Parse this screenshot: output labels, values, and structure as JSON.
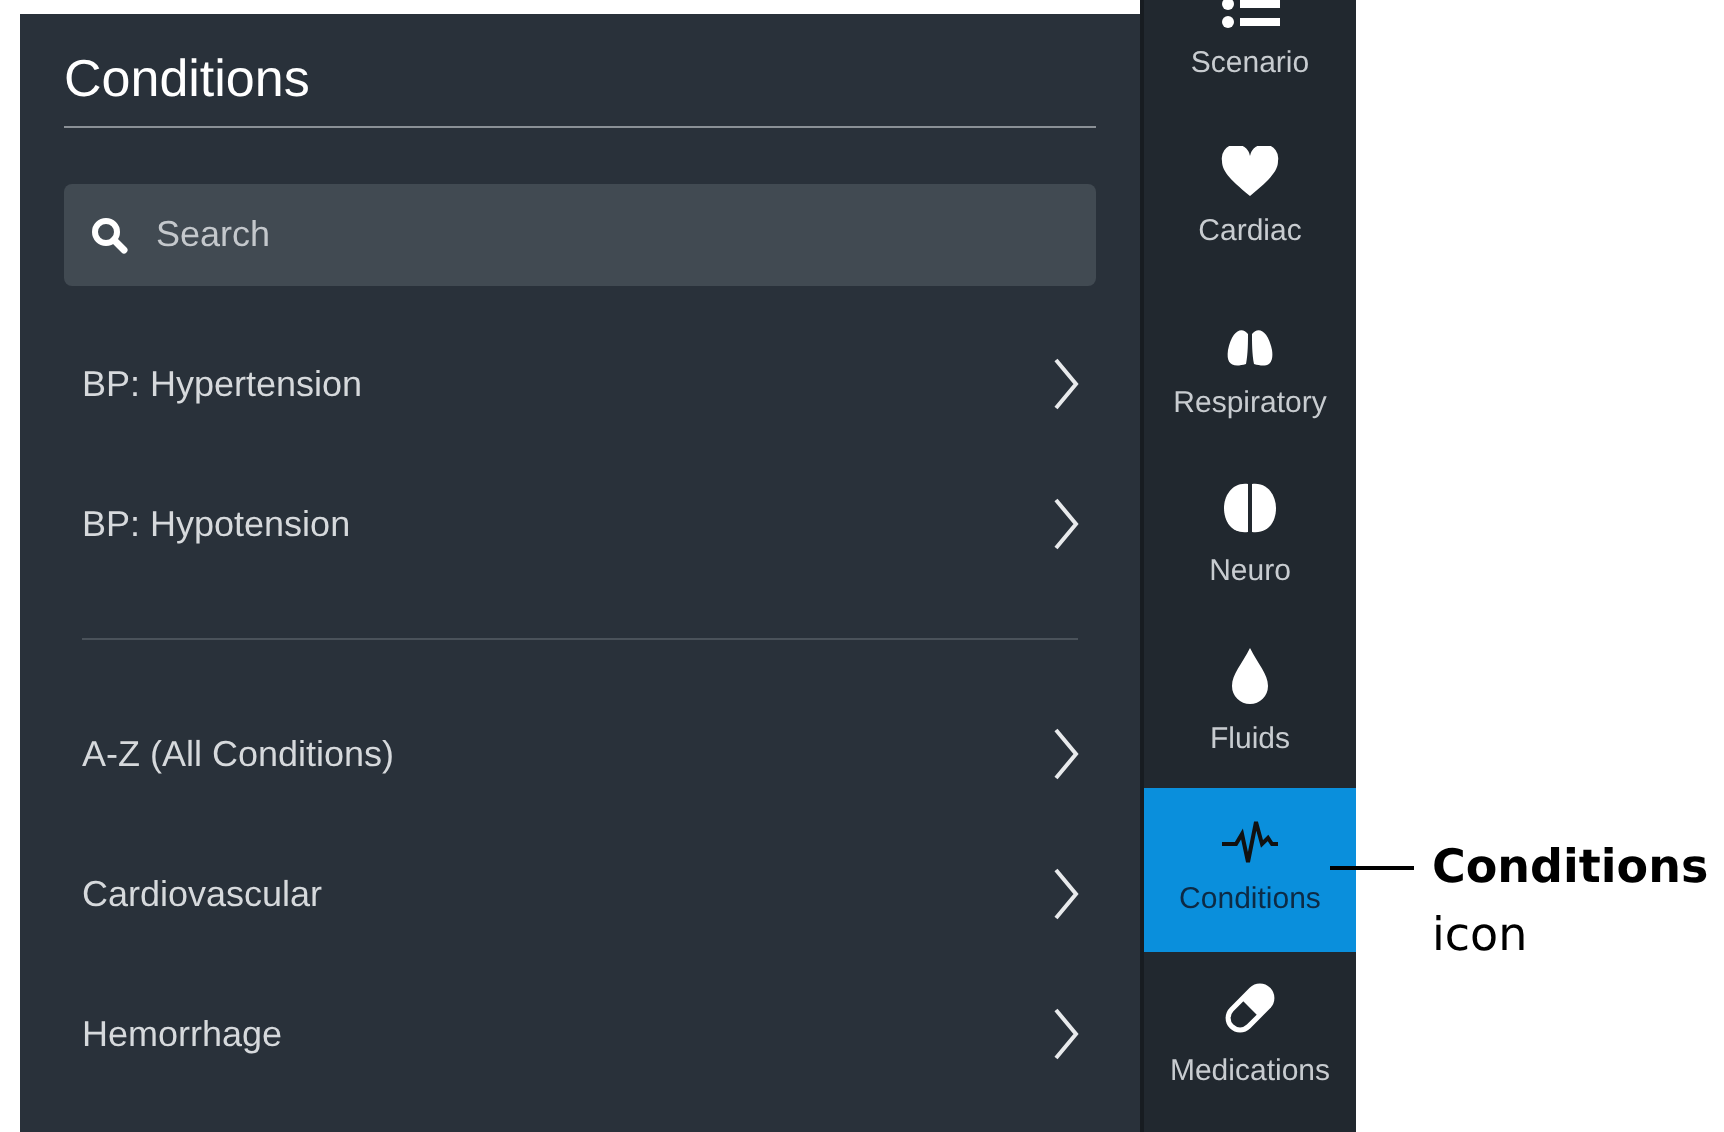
{
  "panel": {
    "title": "Conditions",
    "search": {
      "placeholder": "Search"
    },
    "groups": [
      [
        {
          "label": "BP: Hypertension"
        },
        {
          "label": "BP: Hypotension"
        }
      ],
      [
        {
          "label": "A-Z (All Conditions)"
        },
        {
          "label": "Cardiovascular"
        },
        {
          "label": "Hemorrhage"
        }
      ]
    ]
  },
  "sidebar": {
    "items": [
      {
        "kind": "list",
        "label": "Scenario",
        "selected": false
      },
      {
        "kind": "heart",
        "label": "Cardiac",
        "selected": false
      },
      {
        "kind": "lungs",
        "label": "Respiratory",
        "selected": false
      },
      {
        "kind": "brain",
        "label": "Neuro",
        "selected": false
      },
      {
        "kind": "drop",
        "label": "Fluids",
        "selected": false
      },
      {
        "kind": "pulse",
        "label": "Conditions",
        "selected": true
      },
      {
        "kind": "pill",
        "label": "Medications",
        "selected": false
      }
    ]
  },
  "callout": {
    "title": "Conditions",
    "subtitle": "icon"
  }
}
